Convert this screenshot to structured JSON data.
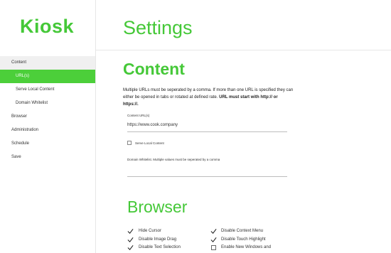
{
  "app": {
    "logo": "Kiosk",
    "page_title": "Settings"
  },
  "sidebar": {
    "items": [
      {
        "label": "Content"
      },
      {
        "label": "URL(s)"
      },
      {
        "label": "Serve Local Content"
      },
      {
        "label": "Domain Whitelist"
      },
      {
        "label": "Browser"
      },
      {
        "label": "Administration"
      },
      {
        "label": "Schedule"
      },
      {
        "label": "Save"
      }
    ]
  },
  "content": {
    "heading": "Content",
    "desc_plain": "Multiple URLs must be seperated by a comma. If more than one URL is specified they can either be opened in tabs or rotated at defined rate.",
    "desc_bold": "URL must start with http:// or https://.",
    "url_label": "Content URL(s)",
    "url_value": "https://www.cook.company",
    "serve_local_label": "Serve Local Content",
    "whitelist_label": "Domain Whitelist. Multiple values must be seperated by a comma"
  },
  "browser": {
    "heading": "Browser",
    "options_left": [
      {
        "label": "Hide Cursor",
        "checked": true
      },
      {
        "label": "Disable Image Drag",
        "checked": true
      },
      {
        "label": "Disable Text Selection",
        "checked": true
      }
    ],
    "options_right": [
      {
        "label": "Disable Context Menu",
        "checked": true
      },
      {
        "label": "Disable Touch Highlight",
        "checked": true
      },
      {
        "label": "Enable New Windows and",
        "checked": false
      }
    ]
  },
  "colors": {
    "accent": "#45c838",
    "active_bg": "#4ccf3a"
  }
}
